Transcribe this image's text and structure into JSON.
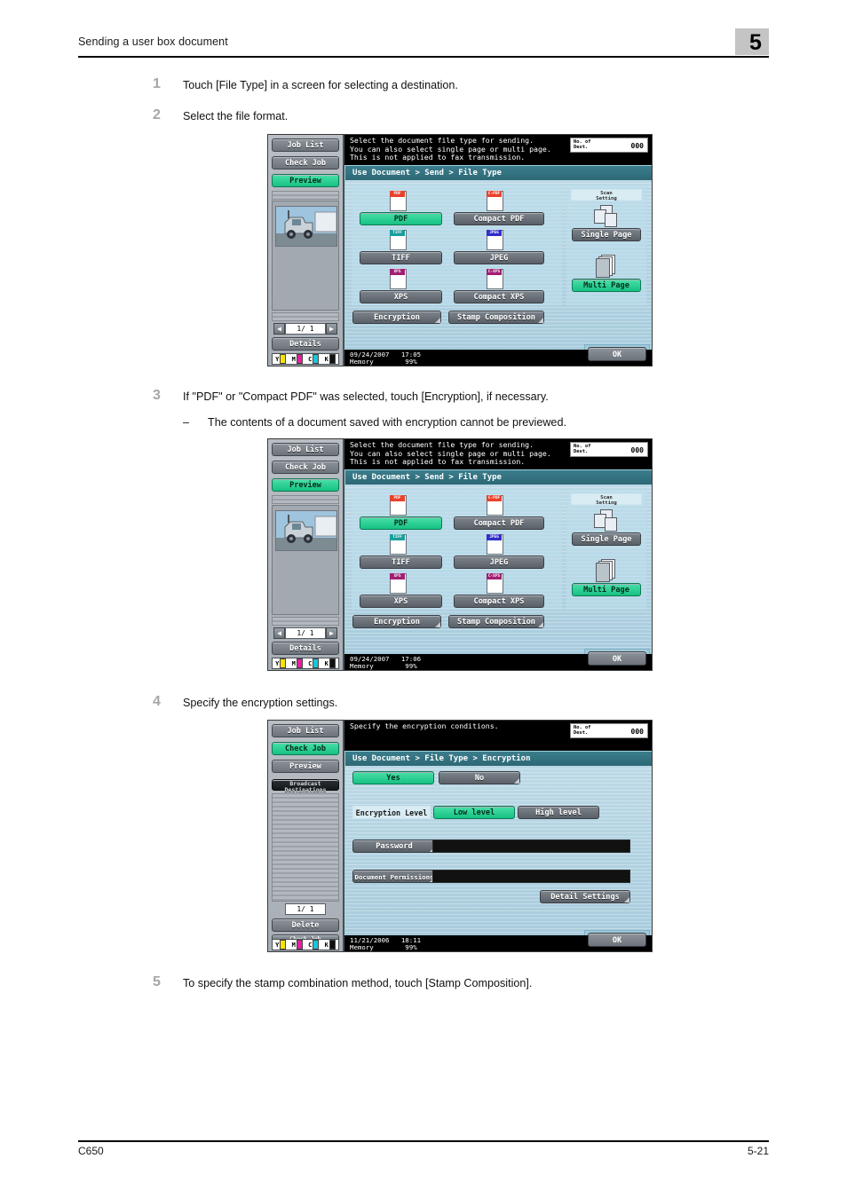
{
  "header": {
    "title": "Sending a user box document",
    "chapter": "5"
  },
  "footer": {
    "model": "C650",
    "page": "5-21"
  },
  "steps": [
    {
      "num": "1",
      "text": "Touch [File Type] in a screen for selecting a destination."
    },
    {
      "num": "2",
      "text": "Select the file format."
    },
    {
      "num": "3",
      "text": "If \"PDF\" or \"Compact PDF\" was selected, touch [Encryption], if necessary.",
      "sub": {
        "dash": "–",
        "text": "The contents of a document saved with encryption cannot be previewed."
      }
    },
    {
      "num": "4",
      "text": "Specify the encryption settings."
    },
    {
      "num": "5",
      "text": "To specify the stamp combination method, touch [Stamp Composition]."
    }
  ],
  "panel1": {
    "rail": {
      "job_list": "Job List",
      "check_job": "Check Job",
      "preview": "Preview",
      "details": "Details",
      "page_indicator": "1/    1",
      "toner": [
        "Y",
        "M",
        "C",
        "K"
      ]
    },
    "info_text": "Select the document file type for sending.\nYou can also select single page or multi page.\nThis is not applied to fax transmission.",
    "dest_label": "No. of\nDest.",
    "dest_value": "000",
    "breadcrumb": "Use Document > Send > File Type",
    "formats": [
      {
        "label": "PDF",
        "tag": "PDF",
        "tag_color": "#e8422d",
        "selected": true
      },
      {
        "label": "Compact PDF",
        "tag": "C-PDF",
        "tag_color": "#e8422d",
        "selected": false
      },
      {
        "label": "TIFF",
        "tag": "TIFF",
        "tag_color": "#1a9e9e",
        "selected": false
      },
      {
        "label": "JPEG",
        "tag": "JPEG",
        "tag_color": "#2f2fc9",
        "selected": false
      },
      {
        "label": "XPS",
        "tag": "XPS",
        "tag_color": "#a01f72",
        "selected": false
      },
      {
        "label": "Compact XPS",
        "tag": "C-XPS",
        "tag_color": "#a01f72",
        "selected": false
      }
    ],
    "scan_setting_label": "Scan\nSetting",
    "single_page": "Single Page",
    "multi_page": "Multi Page",
    "encryption_btn": "Encryption",
    "stamp_btn": "Stamp Composition",
    "status_line1": "09/24/2007   17:05",
    "status_line2": "Memory        99%",
    "ok": "OK"
  },
  "panel2": {
    "rail": {
      "job_list": "Job List",
      "check_job": "Check Job",
      "preview": "Preview",
      "details": "Details",
      "page_indicator": "1/    1",
      "toner": [
        "Y",
        "M",
        "C",
        "K"
      ]
    },
    "info_text": "Select the document file type for sending.\nYou can also select single page or multi page.\nThis is not applied to fax transmission.",
    "dest_label": "No. of\nDest.",
    "dest_value": "000",
    "breadcrumb": "Use Document > Send > File Type",
    "formats": [
      {
        "label": "PDF",
        "tag": "PDF",
        "tag_color": "#e8422d",
        "selected": true
      },
      {
        "label": "Compact PDF",
        "tag": "C-PDF",
        "tag_color": "#e8422d",
        "selected": false
      },
      {
        "label": "TIFF",
        "tag": "TIFF",
        "tag_color": "#1a9e9e",
        "selected": false
      },
      {
        "label": "JPEG",
        "tag": "JPEG",
        "tag_color": "#2f2fc9",
        "selected": false
      },
      {
        "label": "XPS",
        "tag": "XPS",
        "tag_color": "#a01f72",
        "selected": false
      },
      {
        "label": "Compact XPS",
        "tag": "C-XPS",
        "tag_color": "#a01f72",
        "selected": false
      }
    ],
    "scan_setting_label": "Scan\nSetting",
    "single_page": "Single Page",
    "multi_page": "Multi Page",
    "encryption_btn": "Encryption",
    "stamp_btn": "Stamp Composition",
    "status_line1": "09/24/2007   17:06",
    "status_line2": "Memory        99%",
    "ok": "OK"
  },
  "panel3": {
    "rail": {
      "job_list": "Job List",
      "check_job": "Check Job",
      "preview": "Preview",
      "broadcast": "Broadcast\nDestinations",
      "page_indicator": "1/    1",
      "delete": "Delete",
      "check_job_settings": "Check Job\nSettings",
      "toner": [
        "Y",
        "M",
        "C",
        "K"
      ]
    },
    "info_text": "Specify the encryption conditions.",
    "dest_label": "No. of\nDest.",
    "dest_value": "000",
    "breadcrumb": "Use Document > File Type > Encryption",
    "yes": "Yes",
    "no": "No",
    "encryption_level_label": "Encryption Level",
    "low_level": "Low level",
    "high_level": "High level",
    "password": "Password",
    "document_permissions": "Document Permissions",
    "detail_settings": "Detail Settings",
    "status_line1": "11/21/2006   18:11",
    "status_line2": "Memory        99%",
    "ok": "OK"
  }
}
